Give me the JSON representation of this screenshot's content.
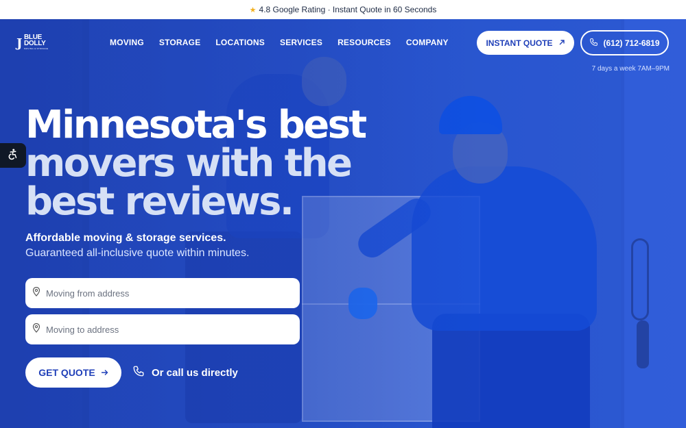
{
  "topbar": {
    "star": "★",
    "text": "4.8 Google Rating · Instant Quote in 60 Seconds"
  },
  "brand": {
    "logo_mark": "J",
    "logo_line1": "BLUE",
    "logo_line2": "DOLLY",
    "logo_sub": "MOVING & STORAGE"
  },
  "nav": {
    "items": [
      "MOVING",
      "STORAGE",
      "LOCATIONS",
      "SERVICES",
      "RESOURCES",
      "COMPANY"
    ]
  },
  "header": {
    "quote_label": "INSTANT QUOTE",
    "phone_label": "(612) 712-6819",
    "hours": "7 days a week 7AM–9PM"
  },
  "hero": {
    "headline_l1": "Minnesota's best",
    "headline_l2": "movers with the",
    "headline_l3": "best reviews.",
    "sub_bold": "Affordable moving & storage services.",
    "sub_regular": "Guaranteed all-inclusive quote within minutes."
  },
  "form": {
    "from_placeholder": "Moving from address",
    "to_placeholder": "Moving to address",
    "get_quote_label": "GET QUOTE",
    "call_label": "Or call us directly"
  },
  "colors": {
    "accent": "#1f3fb8",
    "hero_blue": "#2b55d6",
    "star": "#f2b01e"
  },
  "icons": {
    "topbar": "star-icon",
    "quote": "arrow-up-right-icon",
    "phone": "phone-icon",
    "accessibility": "accessibility-icon",
    "location": "map-pin-icon",
    "get_quote": "arrow-right-icon"
  }
}
